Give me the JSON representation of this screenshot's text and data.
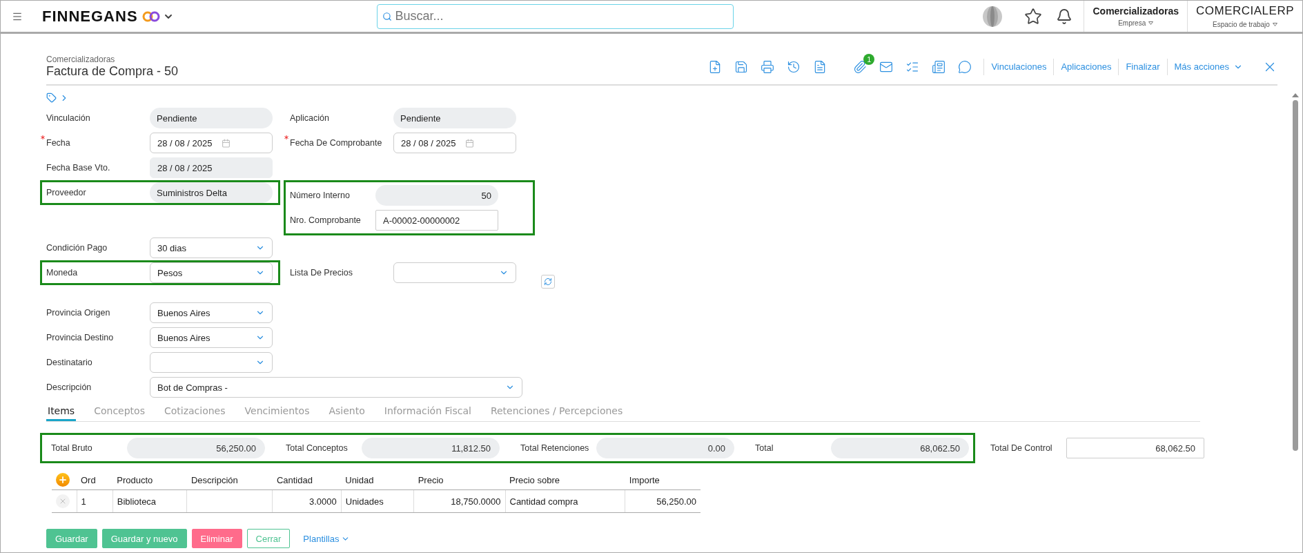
{
  "topbar": {
    "brand": "FINNEGANS",
    "search": {
      "placeholder": "Buscar..."
    },
    "company": {
      "name": "Comercializadoras",
      "caption": "Empresa"
    },
    "workspace": {
      "name": "COMERCIALERP",
      "caption": "Espacio de trabajo"
    }
  },
  "header": {
    "subtitle": "Comercializadoras",
    "title": "Factura de Compra - 50"
  },
  "toolbar": {
    "attachment_count": "1",
    "links": [
      "Vinculaciones",
      "Aplicaciones",
      "Finalizar"
    ],
    "more": "Más acciones"
  },
  "form": {
    "rows": [
      {
        "left": {
          "label": "Vinculación",
          "kind": "pill",
          "value": "Pendiente"
        },
        "right": {
          "label": "Aplicación",
          "kind": "pill",
          "value": "Pendiente"
        }
      },
      {
        "left": {
          "label": "Fecha",
          "kind": "date",
          "required": true,
          "value": "28 / 08 / 2025"
        },
        "right": {
          "label": "Fecha De Comprobante",
          "kind": "date",
          "required": true,
          "value": "28 / 08 / 2025"
        }
      },
      {
        "left": {
          "label": "Fecha Base Vto.",
          "kind": "readonly-date",
          "value": "28 / 08 / 2025"
        }
      },
      {
        "left": {
          "label": "Proveedor",
          "kind": "pill",
          "value": "Suministros Delta",
          "highlighted": true
        },
        "group": {
          "highlighted": true,
          "fields": [
            {
              "label": "Número Interno",
              "kind": "number-pill",
              "value": "50"
            },
            {
              "label": "Nro. Comprobante",
              "kind": "input",
              "value": "A-00002-00000002"
            }
          ]
        }
      },
      {
        "left": {
          "label": "Condición Pago",
          "kind": "select",
          "value": "30 dias"
        }
      },
      {
        "left": {
          "label": "Moneda",
          "kind": "select",
          "value": "Pesos",
          "highlighted": true
        },
        "right": {
          "label": "Lista De Precios",
          "kind": "select",
          "refresh": true
        }
      },
      {
        "left": {
          "label": "Provincia Origen",
          "kind": "select",
          "value": "Buenos Aires"
        }
      },
      {
        "left": {
          "label": "Provincia Destino",
          "kind": "select",
          "value": "Buenos Aires"
        }
      },
      {
        "left": {
          "label": "Destinatario",
          "kind": "select"
        }
      },
      {
        "left": {
          "label": "Descripción",
          "kind": "wide-select",
          "value": "Bot de Compras -"
        }
      }
    ]
  },
  "tabs": [
    {
      "label": "Items",
      "selected": true
    },
    {
      "label": "Conceptos",
      "selected": false
    },
    {
      "label": "Cotizaciones",
      "selected": false
    },
    {
      "label": "Vencimientos",
      "selected": false
    },
    {
      "label": "Asiento",
      "selected": false
    },
    {
      "label": "Información Fiscal",
      "selected": false
    },
    {
      "label": "Retenciones / Percepciones",
      "selected": false
    }
  ],
  "totals": {
    "highlighted": true,
    "items": [
      {
        "label": "Total Bruto",
        "value": "56,250.00"
      },
      {
        "label": "Total Conceptos",
        "value": "11,812.50"
      },
      {
        "label": "Total Retenciones",
        "value": "0.00"
      },
      {
        "label": "Total",
        "value": "68,062.50"
      }
    ],
    "control": {
      "label": "Total De Control",
      "value": "68,062.50"
    }
  },
  "table": {
    "columns": [
      "Ord",
      "Producto",
      "Descripción",
      "Cantidad",
      "Unidad",
      "Precio",
      "Precio sobre",
      "Importe"
    ],
    "rows": [
      [
        "1",
        "Biblioteca",
        "",
        "3.0000",
        "Unidades",
        "18,750.0000",
        "Cantidad compra",
        "56,250.00"
      ]
    ]
  },
  "actions": [
    {
      "label": "Guardar",
      "kind": "primary"
    },
    {
      "label": "Guardar y nuevo",
      "kind": "primary"
    },
    {
      "label": "Eliminar",
      "kind": "danger"
    },
    {
      "label": "Cerrar",
      "kind": "outline"
    },
    {
      "label": "Plantillas",
      "kind": "link"
    }
  ]
}
